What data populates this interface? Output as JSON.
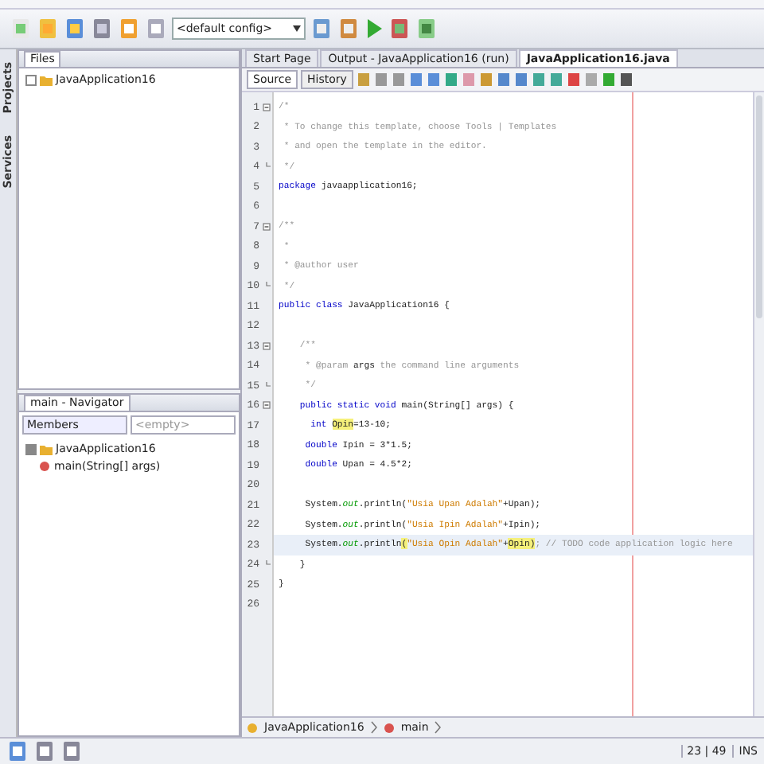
{
  "toolbar": {
    "config": "<default config>"
  },
  "side_tabs": [
    "Projects",
    "Services"
  ],
  "files_panel": {
    "title": "Files",
    "tree": [
      {
        "label": "JavaApplication16",
        "expanded": false
      }
    ]
  },
  "navigator": {
    "title": "main - Navigator",
    "filter": "Members",
    "placeholder": "<empty>",
    "tree": [
      {
        "label": "JavaApplication16",
        "expanded": true,
        "children": [
          {
            "label": "main(String[] args)"
          }
        ]
      }
    ]
  },
  "editor_tabs": [
    {
      "label": "Start Page",
      "selected": false
    },
    {
      "label": "Output - JavaApplication16 (run)",
      "selected": false
    },
    {
      "label": "JavaApplication16.java",
      "selected": true
    }
  ],
  "view_tabs": [
    {
      "label": "Source",
      "selected": true
    },
    {
      "label": "History",
      "selected": false
    }
  ],
  "code": [
    {
      "n": "1",
      "fold_start": true,
      "current": false,
      "tokens": [
        {
          "t": "/*",
          "kind": "comment"
        }
      ]
    },
    {
      "n": "2",
      "current": false,
      "tokens": [
        {
          "t": " * To change this template, choose Tools | Templates",
          "kind": "comment"
        }
      ]
    },
    {
      "n": "3",
      "current": false,
      "tokens": [
        {
          "t": " * and open the template in the editor.",
          "kind": "comment"
        }
      ]
    },
    {
      "n": "4",
      "fold_end": true,
      "current": false,
      "tokens": [
        {
          "t": " */",
          "kind": "comment"
        }
      ]
    },
    {
      "n": "5",
      "current": false,
      "tokens": [
        {
          "t": "package",
          "kind": "keyword"
        },
        {
          "t": " javaapplication16;",
          "kind": "plain"
        }
      ]
    },
    {
      "n": "6",
      "current": false
    },
    {
      "n": "7",
      "fold_start": true,
      "current": false,
      "tokens": [
        {
          "t": "/**",
          "kind": "comment"
        }
      ]
    },
    {
      "n": "8",
      "current": false,
      "tokens": [
        {
          "t": " *",
          "kind": "comment"
        }
      ]
    },
    {
      "n": "9",
      "current": false,
      "tokens": [
        {
          "t": " * @author user",
          "kind": "comment"
        }
      ]
    },
    {
      "n": "10",
      "fold_end": true,
      "current": false,
      "tokens": [
        {
          "t": " */",
          "kind": "comment"
        }
      ]
    },
    {
      "n": "11",
      "current": false,
      "tokens": [
        {
          "t": "public class",
          "kind": "keyword"
        },
        {
          "t": " JavaApplication16 {",
          "kind": "plain"
        }
      ]
    },
    {
      "n": "12",
      "current": false
    },
    {
      "n": "13",
      "fold_start": true,
      "current": false,
      "tokens": [
        {
          "t": "    /**",
          "kind": "comment"
        }
      ]
    },
    {
      "n": "14",
      "current": false,
      "tokens": [
        {
          "t": "     * @param ",
          "kind": "comment"
        },
        {
          "t": "args",
          "kind": "plain"
        },
        {
          "t": " the command line arguments",
          "kind": "comment"
        }
      ]
    },
    {
      "n": "15",
      "fold_end": true,
      "current": false,
      "tokens": [
        {
          "t": "     */",
          "kind": "comment"
        }
      ]
    },
    {
      "n": "16",
      "fold_start": true,
      "current": false,
      "tokens": [
        {
          "t": "    public static void",
          "kind": "keyword"
        },
        {
          "t": " main(String[] args) {",
          "kind": "plain"
        }
      ]
    },
    {
      "n": "17",
      "current": false,
      "tokens": [
        {
          "t": "      int ",
          "kind": "keyword"
        },
        {
          "t": "Opin",
          "kind": "mark"
        },
        {
          "t": "=13-10;",
          "kind": "plain"
        }
      ]
    },
    {
      "n": "18",
      "current": false,
      "tokens": [
        {
          "t": "     double",
          "kind": "keyword"
        },
        {
          "t": " Ipin = 3*1.5;",
          "kind": "plain"
        }
      ]
    },
    {
      "n": "19",
      "current": false,
      "tokens": [
        {
          "t": "     double",
          "kind": "keyword"
        },
        {
          "t": " Upan = 4.5*2;",
          "kind": "plain"
        }
      ]
    },
    {
      "n": "20",
      "current": false
    },
    {
      "n": "21",
      "current": false,
      "tokens": [
        {
          "t": "     System.",
          "kind": "plain"
        },
        {
          "t": "out",
          "kind": "field"
        },
        {
          "t": ".println(",
          "kind": "plain"
        },
        {
          "t": "\"Usia Upan Adalah\"",
          "kind": "string"
        },
        {
          "t": "+Upan);",
          "kind": "plain"
        }
      ]
    },
    {
      "n": "22",
      "current": false,
      "tokens": [
        {
          "t": "     System.",
          "kind": "plain"
        },
        {
          "t": "out",
          "kind": "field"
        },
        {
          "t": ".println(",
          "kind": "plain"
        },
        {
          "t": "\"Usia Ipin Adalah\"",
          "kind": "string"
        },
        {
          "t": "+Ipin);",
          "kind": "plain"
        }
      ]
    },
    {
      "n": "23",
      "current": true,
      "tokens": [
        {
          "t": "     System.",
          "kind": "plain"
        },
        {
          "t": "out",
          "kind": "field"
        },
        {
          "t": ".println",
          "kind": "plain"
        },
        {
          "t": "(",
          "kind": "mark"
        },
        {
          "t": "\"Usia Opin Adalah\"",
          "kind": "string"
        },
        {
          "t": "+",
          "kind": "plain"
        },
        {
          "t": "Opin",
          "kind": "mark"
        },
        {
          "t": ")",
          "kind": "mark"
        },
        {
          "t": "; // TODO code application logic here",
          "kind": "comment"
        }
      ]
    },
    {
      "n": "24",
      "fold_end": true,
      "current": false,
      "tokens": [
        {
          "t": "    }",
          "kind": "plain"
        }
      ]
    },
    {
      "n": "25",
      "current": false,
      "tokens": [
        {
          "t": "}",
          "kind": "plain"
        }
      ]
    },
    {
      "n": "26",
      "current": false
    }
  ],
  "breadcrumbs": [
    "JavaApplication16",
    "main"
  ],
  "status_bar": {
    "position": "23 | 49",
    "mode": "INS"
  }
}
